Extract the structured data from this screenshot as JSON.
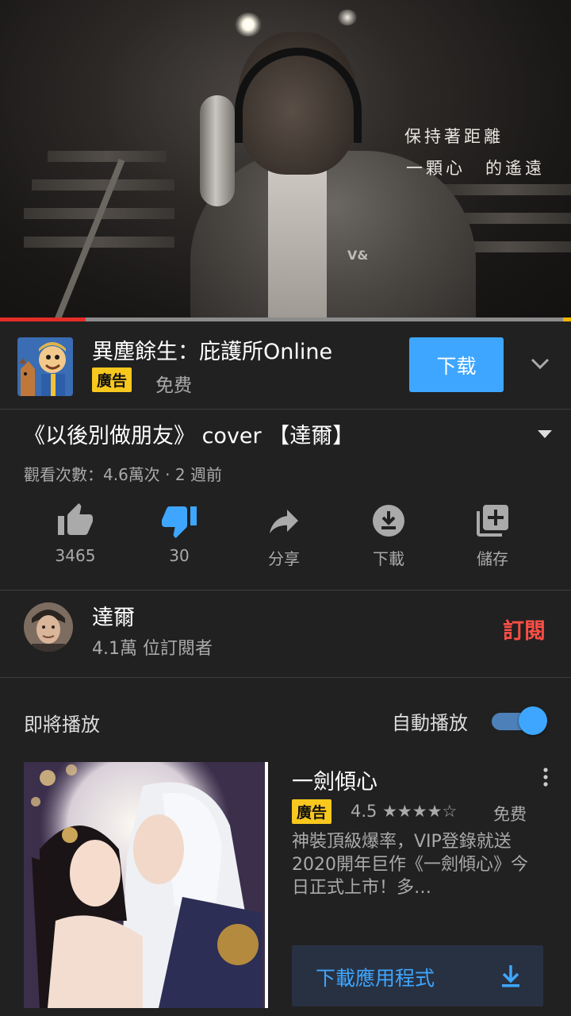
{
  "player": {
    "lyrics": [
      "保持著距離",
      "一顆心　的遙遠"
    ],
    "shirt_logo": "V&",
    "progress_percent": 15
  },
  "ad": {
    "title": "異塵餘生：庇護所Online",
    "badge": "廣告",
    "price": "免费",
    "button_label": "下载",
    "icon": "game-app-icon"
  },
  "video": {
    "title": "《以後別做朋友》 cover 【達爾】",
    "meta": "觀看次數：4.6萬次 · 2 週前"
  },
  "actions": [
    {
      "icon": "thumbs-up-icon",
      "label": "3465"
    },
    {
      "icon": "thumbs-down-icon",
      "label": "30",
      "active": true
    },
    {
      "icon": "share-icon",
      "label": "分享"
    },
    {
      "icon": "download-icon",
      "label": "下載"
    },
    {
      "icon": "save-playlist-icon",
      "label": "儲存"
    }
  ],
  "channel": {
    "name": "達爾",
    "subscribers": "4.1萬 位訂閱者",
    "subscribe_label": "訂閱"
  },
  "up_next": {
    "label": "即將播放",
    "autoplay_label": "自動播放",
    "autoplay_on": true
  },
  "recommended_ad": {
    "title": "一劍傾心",
    "badge": "廣告",
    "rating_value": "4.5",
    "stars": "★★★★☆",
    "price": "免费",
    "description": "神裝頂級爆率，VIP登錄就送 2020開年巨作《一劍傾心》今日正式上市！多…",
    "cta_label": "下載應用程式"
  },
  "colors": {
    "background": "#212121",
    "accent_blue": "#3ea6ff",
    "subscribe_red": "#ff4e45",
    "ad_badge_yellow": "#f9c81e",
    "progress_red": "#e52d27"
  }
}
